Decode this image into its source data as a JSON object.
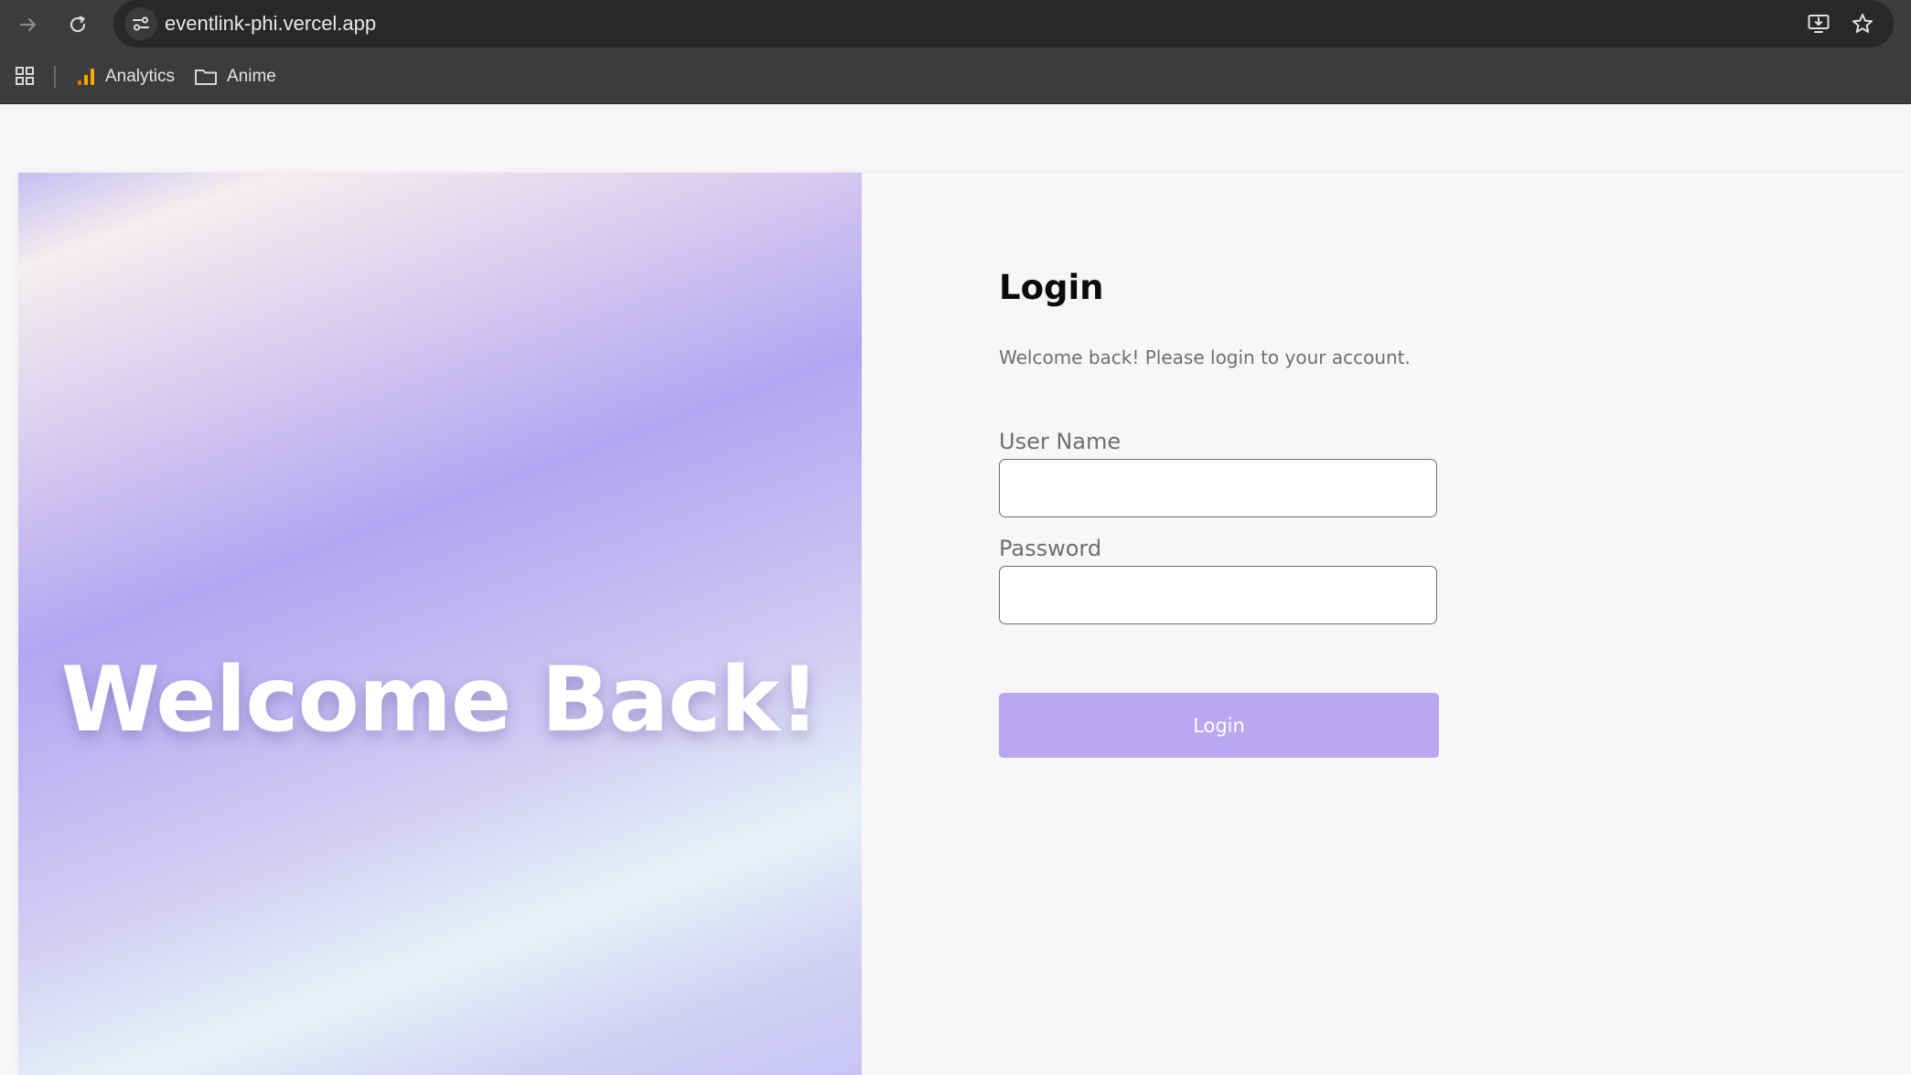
{
  "browser": {
    "url": "eventlink-phi.vercel.app",
    "bookmarks": [
      {
        "label": "Analytics",
        "icon": "analytics-icon"
      },
      {
        "label": "Anime",
        "icon": "folder-icon"
      }
    ]
  },
  "hero": {
    "title": "Welcome Back!"
  },
  "login": {
    "title": "Login",
    "subtitle": "Welcome back! Please login to your account.",
    "username_label": "User Name",
    "username_value": "",
    "password_label": "Password",
    "password_value": "",
    "button_label": "Login"
  },
  "colors": {
    "accent": "#b7a8f0",
    "chrome": "#3c3c3c",
    "page_bg": "#f8f6f8"
  }
}
